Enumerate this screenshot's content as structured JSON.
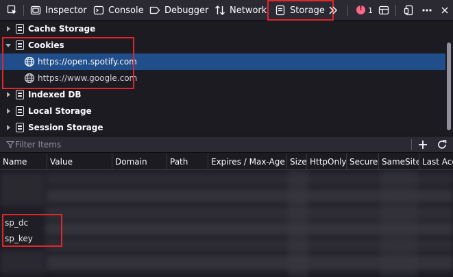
{
  "toolbar": {
    "tabs": [
      {
        "label": "Inspector",
        "icon": "inspector-icon"
      },
      {
        "label": "Console",
        "icon": "console-icon"
      },
      {
        "label": "Debugger",
        "icon": "debugger-icon"
      },
      {
        "label": "Network",
        "icon": "network-icon"
      },
      {
        "label": "Storage",
        "icon": "storage-icon",
        "selected": true
      }
    ],
    "error_count": "1",
    "colors": {
      "background": "#2b2a33",
      "text": "#fbfbfe",
      "highlight": "#e0262b",
      "error": "#ff6a8a"
    }
  },
  "tree": {
    "items": [
      {
        "label": "Cache Storage",
        "expanded": false
      },
      {
        "label": "Cookies",
        "expanded": true,
        "children": [
          {
            "label": "https://open.spotify.com",
            "selected": true
          },
          {
            "label": "https://www.google.com",
            "selected": false
          }
        ]
      },
      {
        "label": "Indexed DB",
        "expanded": false
      },
      {
        "label": "Local Storage",
        "expanded": false
      },
      {
        "label": "Session Storage",
        "expanded": false
      }
    ],
    "selected_color": "#204e8a"
  },
  "filter": {
    "placeholder": "Filter Items"
  },
  "table": {
    "columns": [
      "Name",
      "Value",
      "Domain",
      "Path",
      "Expires / Max-Age",
      "Size",
      "HttpOnly",
      "Secure",
      "SameSite",
      "Last Acce"
    ],
    "visible_names": [
      "sp_dc",
      "sp_key"
    ]
  }
}
